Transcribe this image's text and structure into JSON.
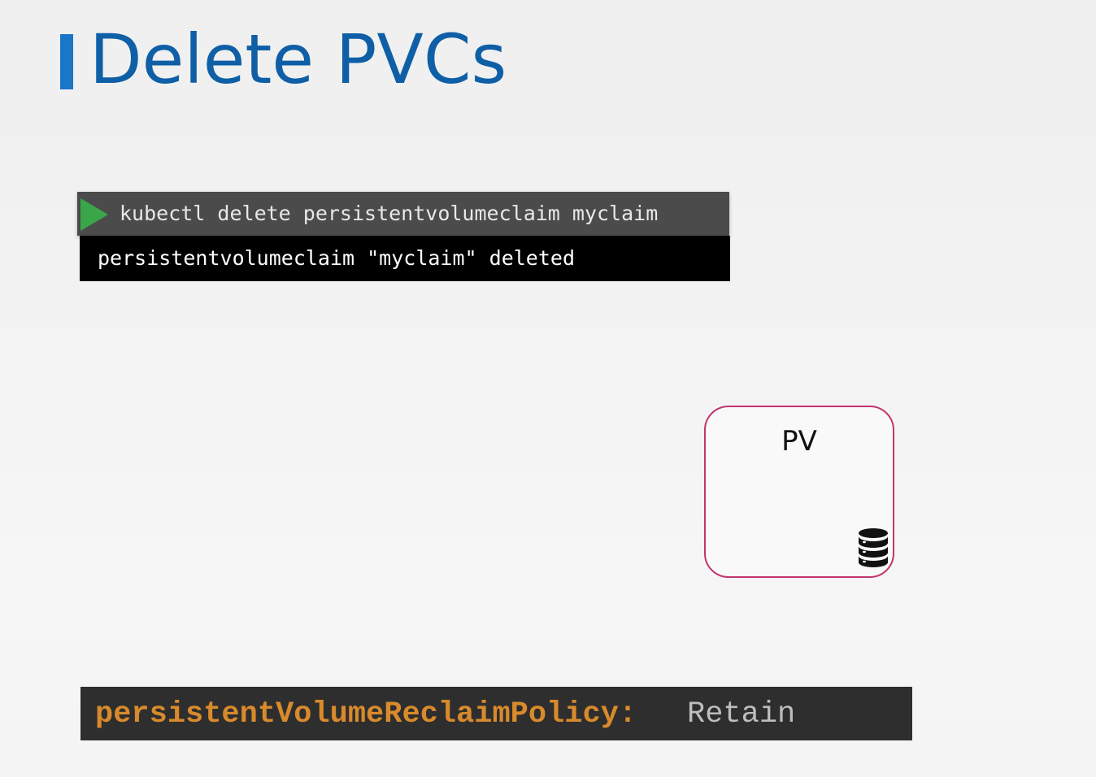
{
  "slide": {
    "title": "Delete PVCs"
  },
  "terminal": {
    "command": "kubectl delete persistentvolumeclaim myclaim",
    "output": "persistentvolumeclaim \"myclaim\" deleted",
    "prompt_icon": "play-icon",
    "prompt_color": "#3aa64a"
  },
  "pv": {
    "label": "PV",
    "icon": "database-icon",
    "border_color": "#c2366f"
  },
  "policy": {
    "key": "persistentVolumeReclaimPolicy:",
    "value": "Retain",
    "key_color": "#d88a2c"
  },
  "colors": {
    "title": "#0f5fa6",
    "accent_bar": "#1a76c7"
  }
}
